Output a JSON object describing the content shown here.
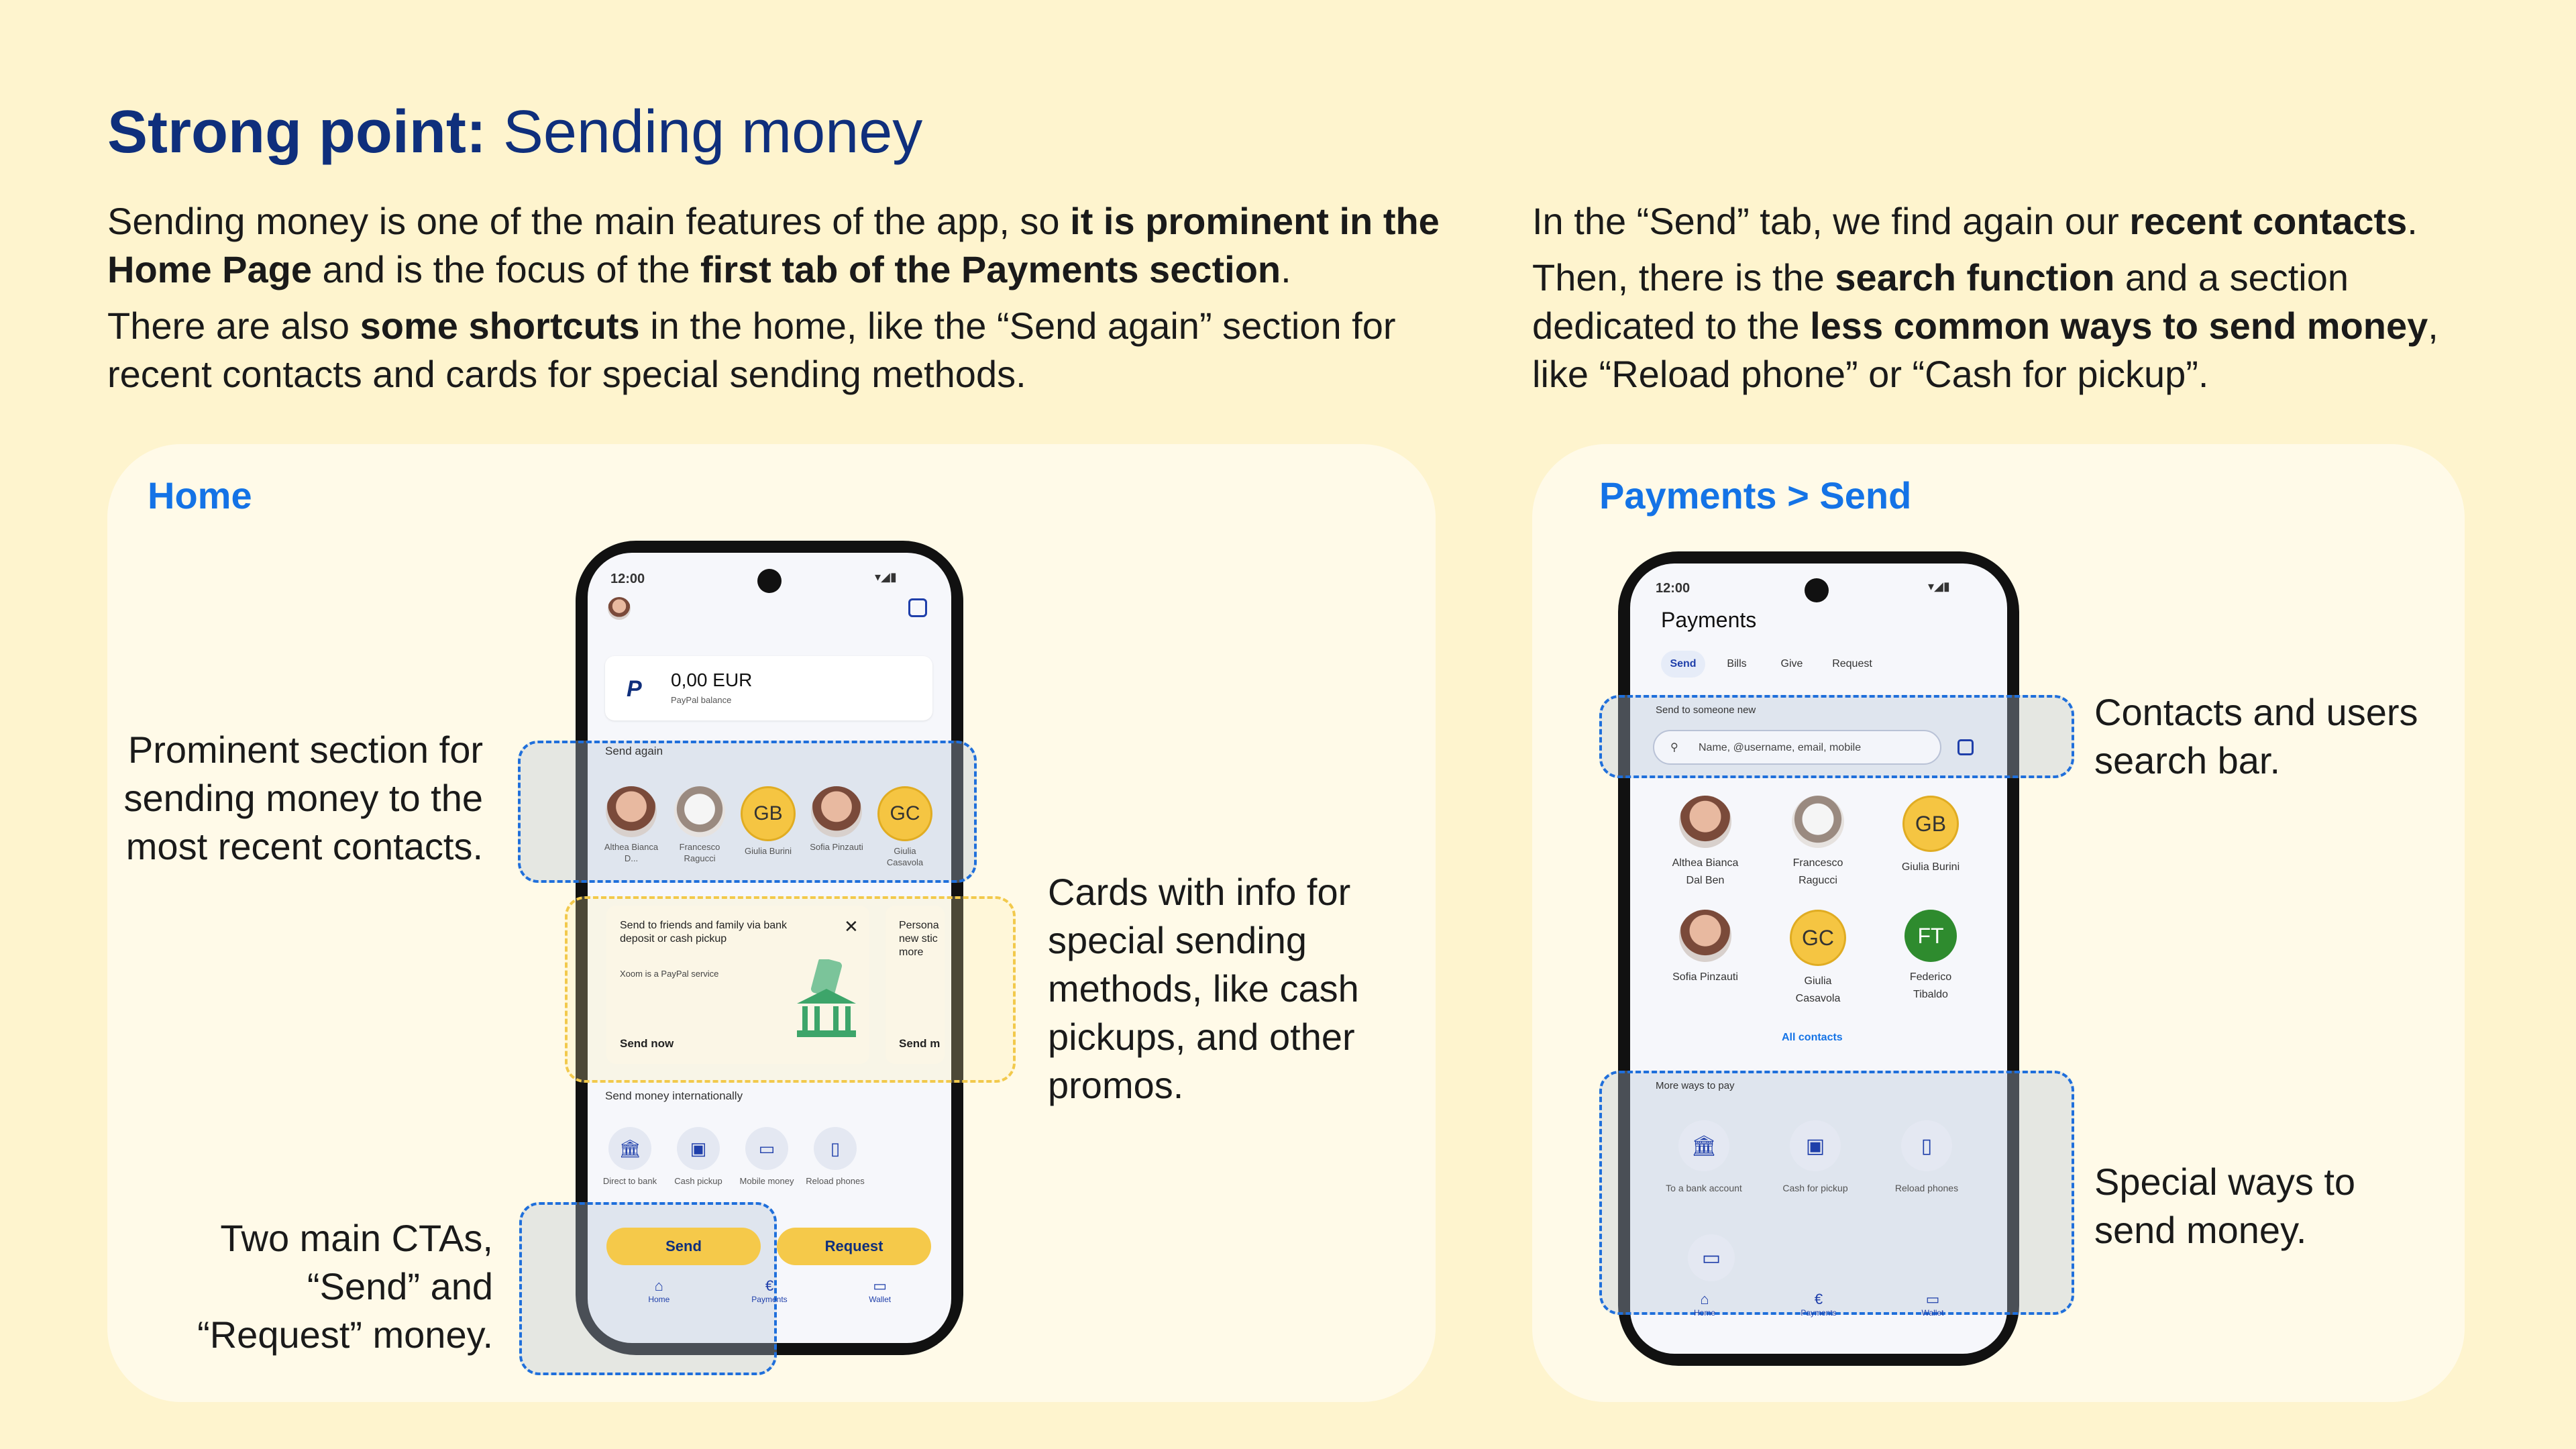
{
  "header": {
    "title_bold": "Strong point:",
    "title_rest": " Sending money"
  },
  "intro_left": {
    "p1_a": "Sending money is one of the main features of the app, so ",
    "p1_b": "it is prominent in the Home Page",
    "p1_c": " and is the focus of the ",
    "p1_d": "first tab of the Payments section",
    "p1_e": ".",
    "p2_a": "There are also ",
    "p2_b": "some shortcuts",
    "p2_c": " in the home, like the “Send again” section for recent contacts and cards for special sending methods."
  },
  "intro_right": {
    "p1_a": "In the “Send” tab, we find again our ",
    "p1_b": "recent contacts",
    "p1_c": ".",
    "p2_a": "Then, there is the ",
    "p2_b": "search function",
    "p2_c": " and a section dedicated to the ",
    "p2_d": "less common ways to send money",
    "p2_e": ", like “Reload phone” or “Cash for pickup”."
  },
  "home_panel": {
    "title": "Home",
    "annot_recent": "Prominent section for sending money to the most recent contacts.",
    "annot_cards": "Cards with info for special sending methods, like cash pickups, and other promos.",
    "annot_ctas": "Two main CTAs, “Send” and “Request” money.",
    "phone": {
      "time": "12:00",
      "balance": "0,00 EUR",
      "balance_label": "PayPal balance",
      "send_again": "Send again",
      "contacts": [
        {
          "name": "Althea Bianca D...",
          "initials": "",
          "style": "photo"
        },
        {
          "name": "Francesco Ragucci",
          "initials": "",
          "style": "dog"
        },
        {
          "name": "Giulia Burini",
          "initials": "GB",
          "style": "yellow"
        },
        {
          "name": "Sofia Pinzauti",
          "initials": "",
          "style": "photo"
        },
        {
          "name": "Giulia Casavola",
          "initials": "GC",
          "style": "yellow"
        }
      ],
      "card1_text": "Send to friends and family via bank deposit or cash pickup",
      "card1_sub": "Xoom is a PayPal service",
      "card1_cta": "Send now",
      "card2_text": "Persona new stic more",
      "card2_cta": "Send m",
      "intl_title": "Send money internationally",
      "intl_items": [
        "Direct to bank",
        "Cash pickup",
        "Mobile money",
        "Reload phones"
      ],
      "send_btn": "Send",
      "request_btn": "Request",
      "nav": [
        "Home",
        "Payments",
        "Wallet"
      ]
    }
  },
  "payments_panel": {
    "title": "Payments > Send",
    "annot_search": "Contacts and users search bar.",
    "annot_special": "Special ways to send money.",
    "phone": {
      "time": "12:00",
      "screen_title": "Payments",
      "tabs": [
        "Send",
        "Bills",
        "Give",
        "Request"
      ],
      "send_new": "Send to someone new",
      "search_placeholder": "Name, @username, email, mobile",
      "contacts": [
        {
          "name": "Althea Bianca Dal Ben",
          "initials": "",
          "style": "photo"
        },
        {
          "name": "Francesco Ragucci",
          "initials": "",
          "style": "dog"
        },
        {
          "name": "Giulia Burini",
          "initials": "GB",
          "style": "yellow"
        },
        {
          "name": "Sofia Pinzauti",
          "initials": "",
          "style": "photo"
        },
        {
          "name": "Giulia Casavola",
          "initials": "GC",
          "style": "yellow"
        },
        {
          "name": "Federico Tibaldo",
          "initials": "FT",
          "style": "green"
        }
      ],
      "all_contacts": "All contacts",
      "more_ways": "More ways to pay",
      "ways": [
        "To a bank account",
        "Cash for pickup",
        "Reload phones"
      ],
      "nav": [
        "Home",
        "Payments",
        "Wallet"
      ]
    }
  },
  "colors": {
    "background": "#FEF4CE",
    "title_blue": "#0F2F7C",
    "panel_title_blue": "#1473E6",
    "cta_yellow": "#F5C94A"
  }
}
